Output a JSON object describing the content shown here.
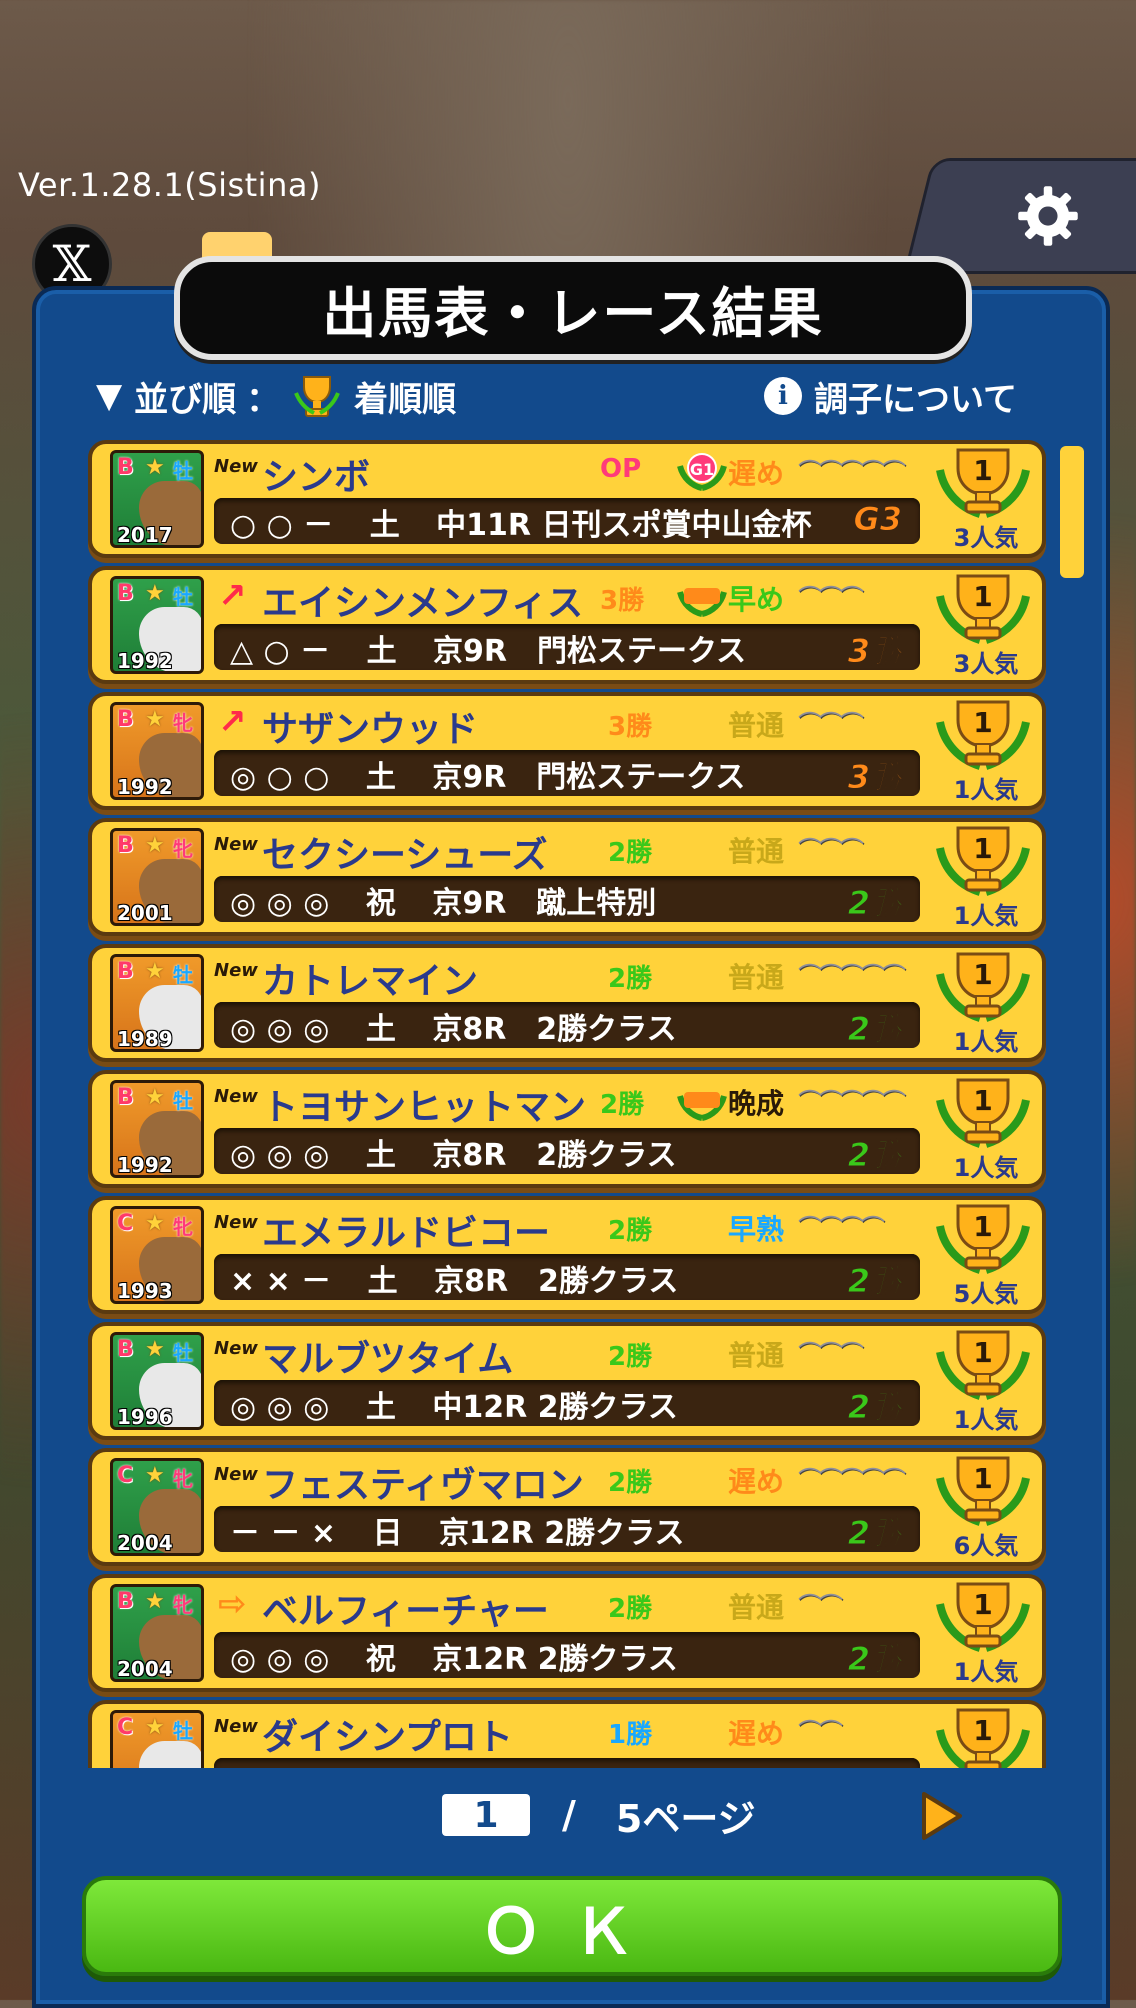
{
  "version": "Ver.1.28.1(Sistina)",
  "title": "出馬表・レース結果",
  "sort": {
    "label": "並び順",
    "colon": "：",
    "value": "着順順"
  },
  "about": "調子について",
  "colors": {
    "panel": "#124a8c",
    "row": "#ffd23a",
    "ok": "#5bd01a"
  },
  "rows": [
    {
      "rank": "B",
      "sex": "牡",
      "sex_type": "m",
      "year": "2017",
      "tag": "New",
      "arrow": "",
      "name": "シンボ",
      "cls": "OP",
      "cls_color": "#ff3a7a",
      "grade_icon": "G1-icon",
      "growth": "遅め",
      "growth_color": "#ff8a1a",
      "shoes": "⌒⌒⌒⌒⌒",
      "marks": "○ ○ －",
      "day": "土",
      "race": "中11R 日刊スポ賞中山金杯",
      "rgrade": "G3",
      "rgrade_color": "#ff8a1a",
      "finish": "1",
      "pop": "3人気",
      "bg": "green"
    },
    {
      "rank": "B",
      "sex": "牡",
      "sex_type": "m",
      "year": "1992",
      "tag": "",
      "arrow": "↗",
      "name": "エイシンメンフィス",
      "cls": "3勝",
      "cls_color": "#ff8a1a",
      "grade_icon": "重賞-icon",
      "growth": "早め",
      "growth_color": "#3ac81a",
      "shoes": "⌒⌒⌒",
      "marks": "△ ○ －",
      "day": "土",
      "race": "京9R　門松ステークス",
      "rgrade": "3勝",
      "rgrade_color": "#ff8a1a",
      "finish": "1",
      "pop": "3人気",
      "bg": "green"
    },
    {
      "rank": "B",
      "sex": "牝",
      "sex_type": "f",
      "year": "1992",
      "tag": "",
      "arrow": "↗",
      "name": "サザンウッド",
      "cls": "3勝",
      "cls_color": "#ff8a1a",
      "grade_icon": "",
      "growth": "普通",
      "growth_color": "#c8a81a",
      "shoes": "⌒⌒⌒",
      "marks": "◎ ○ ○",
      "day": "土",
      "race": "京9R　門松ステークス",
      "rgrade": "3勝",
      "rgrade_color": "#ff8a1a",
      "finish": "1",
      "pop": "1人気",
      "bg": "orange"
    },
    {
      "rank": "B",
      "sex": "牝",
      "sex_type": "f",
      "year": "2001",
      "tag": "New",
      "arrow": "",
      "name": "セクシーシューズ",
      "cls": "2勝",
      "cls_color": "#3ac81a",
      "grade_icon": "",
      "growth": "普通",
      "growth_color": "#c8a81a",
      "shoes": "⌒⌒⌒",
      "marks": "◎ ◎ ◎",
      "day": "祝",
      "race": "京9R　蹴上特別",
      "rgrade": "2勝",
      "rgrade_color": "#3ac81a",
      "finish": "1",
      "pop": "1人気",
      "bg": "orange"
    },
    {
      "rank": "B",
      "sex": "牡",
      "sex_type": "m",
      "year": "1989",
      "tag": "New",
      "arrow": "",
      "name": "カトレマイン",
      "cls": "2勝",
      "cls_color": "#3ac81a",
      "grade_icon": "",
      "growth": "普通",
      "growth_color": "#c8a81a",
      "shoes": "⌒⌒⌒⌒⌒",
      "marks": "◎ ◎ ◎",
      "day": "土",
      "race": "京8R　2勝クラス",
      "rgrade": "2勝",
      "rgrade_color": "#3ac81a",
      "finish": "1",
      "pop": "1人気",
      "bg": "orange"
    },
    {
      "rank": "B",
      "sex": "牡",
      "sex_type": "m",
      "year": "1992",
      "tag": "New",
      "arrow": "",
      "name": "トヨサンヒットマン",
      "cls": "2勝",
      "cls_color": "#3ac81a",
      "grade_icon": "重賞-icon",
      "growth": "晩成",
      "growth_color": "#2a1a08",
      "shoes": "⌒⌒⌒⌒⌒",
      "marks": "◎ ◎ ◎",
      "day": "土",
      "race": "京8R　2勝クラス",
      "rgrade": "2勝",
      "rgrade_color": "#3ac81a",
      "finish": "1",
      "pop": "1人気",
      "bg": "orange"
    },
    {
      "rank": "C",
      "sex": "牝",
      "sex_type": "f",
      "year": "1993",
      "tag": "New",
      "arrow": "",
      "name": "エメラルドビコー",
      "cls": "2勝",
      "cls_color": "#3ac81a",
      "grade_icon": "",
      "growth": "早熟",
      "growth_color": "#1aa8ff",
      "shoes": "⌒⌒⌒⌒",
      "marks": "× × －",
      "day": "土",
      "race": "京8R　2勝クラス",
      "rgrade": "2勝",
      "rgrade_color": "#3ac81a",
      "finish": "1",
      "pop": "5人気",
      "bg": "orange"
    },
    {
      "rank": "B",
      "sex": "牡",
      "sex_type": "m",
      "year": "1996",
      "tag": "New",
      "arrow": "",
      "name": "マルブツタイム",
      "cls": "2勝",
      "cls_color": "#3ac81a",
      "grade_icon": "",
      "growth": "普通",
      "growth_color": "#c8a81a",
      "shoes": "⌒⌒⌒",
      "marks": "◎ ◎ ◎",
      "day": "土",
      "race": "中12R 2勝クラス",
      "rgrade": "2勝",
      "rgrade_color": "#3ac81a",
      "finish": "1",
      "pop": "1人気",
      "bg": "green"
    },
    {
      "rank": "C",
      "sex": "牝",
      "sex_type": "f",
      "year": "2004",
      "tag": "New",
      "arrow": "",
      "name": "フェスティヴマロン",
      "cls": "2勝",
      "cls_color": "#3ac81a",
      "grade_icon": "",
      "growth": "遅め",
      "growth_color": "#ff8a1a",
      "shoes": "⌒⌒⌒⌒⌒",
      "marks": "－ － ×",
      "day": "日",
      "race": "京12R 2勝クラス",
      "rgrade": "2勝",
      "rgrade_color": "#3ac81a",
      "finish": "1",
      "pop": "6人気",
      "bg": "green"
    },
    {
      "rank": "B",
      "sex": "牝",
      "sex_type": "f",
      "year": "2004",
      "tag": "",
      "arrow": "⇨",
      "name": "ベルフィーチャー",
      "cls": "2勝",
      "cls_color": "#3ac81a",
      "grade_icon": "",
      "growth": "普通",
      "growth_color": "#c8a81a",
      "shoes": "⌒⌒",
      "marks": "◎ ◎ ◎",
      "day": "祝",
      "race": "京12R 2勝クラス",
      "rgrade": "2勝",
      "rgrade_color": "#3ac81a",
      "finish": "1",
      "pop": "1人気",
      "bg": "green"
    },
    {
      "rank": "C",
      "sex": "牡",
      "sex_type": "m",
      "year": "",
      "tag": "New",
      "arrow": "",
      "name": "ダイシンプロト",
      "cls": "1勝",
      "cls_color": "#1aa8ff",
      "grade_icon": "",
      "growth": "遅め",
      "growth_color": "#ff8a1a",
      "shoes": "⌒⌒",
      "marks": "",
      "day": "",
      "race": "",
      "rgrade": "",
      "rgrade_color": "#3ac81a",
      "finish": "1",
      "pop": "",
      "bg": "orange"
    }
  ],
  "pager": {
    "current": "1",
    "sep": "/",
    "total": "5ページ"
  },
  "ok_label": "ＯＫ"
}
